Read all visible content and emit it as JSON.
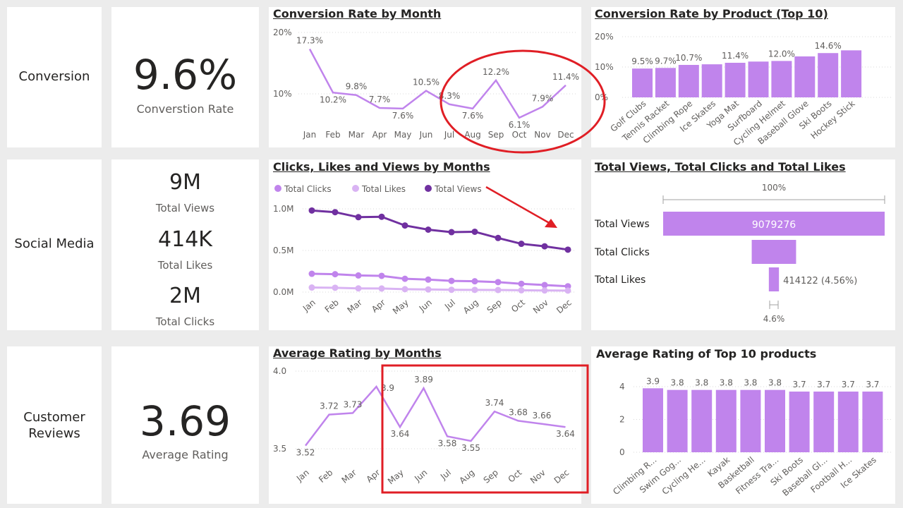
{
  "colors": {
    "accent": "#c084ec",
    "dark": "#7030a0",
    "light": "#d9b3f3",
    "annotation": "#e01e25"
  },
  "sections": {
    "conversion": "Conversion",
    "social": "Social Media",
    "reviews_line1": "Customer",
    "reviews_line2": "Reviews"
  },
  "kpis": {
    "conversion_value": "9.6%",
    "conversion_label": "Converstion Rate",
    "views_value": "9M",
    "views_label": "Total Views",
    "likes_value": "414K",
    "likes_label": "Total Likes",
    "clicks_value": "2M",
    "clicks_label": "Total Clicks",
    "rating_value": "3.69",
    "rating_label": "Average Rating"
  },
  "months": [
    "Jan",
    "Feb",
    "Mar",
    "Apr",
    "May",
    "Jun",
    "Jul",
    "Aug",
    "Sep",
    "Oct",
    "Nov",
    "Dec"
  ],
  "chart_data": [
    {
      "type": "line",
      "title": "Conversion Rate by Month",
      "x": [
        "Jan",
        "Feb",
        "Mar",
        "Apr",
        "May",
        "Jun",
        "Jul",
        "Aug",
        "Sep",
        "Oct",
        "Nov",
        "Dec"
      ],
      "values": [
        17.3,
        10.2,
        9.8,
        7.7,
        7.6,
        10.5,
        8.3,
        7.6,
        12.2,
        6.1,
        7.9,
        11.4
      ],
      "labels": [
        "17.3%",
        "10.2%",
        "9.8%",
        "7.7%",
        "7.6%",
        "10.5%",
        "8.3%",
        "7.6%",
        "12.2%",
        "6.1%",
        "7.9%",
        "11.4%"
      ],
      "yticks": [
        "20%",
        "10%"
      ],
      "ylim": [
        0,
        20
      ]
    },
    {
      "type": "bar",
      "title": "Conversion Rate by Product (Top 10)",
      "categories": [
        "Golf Clubs",
        "Tennis Racket",
        "Climbing Rope",
        "Ice Skates",
        "Yoga Mat",
        "Surfboard",
        "Cycling Helmet",
        "Baseball Glove",
        "Ski Boots",
        "Hockey Stick"
      ],
      "values": [
        9.5,
        9.7,
        10.7,
        10.9,
        11.4,
        11.8,
        12.0,
        13.5,
        14.6,
        15.5
      ],
      "labels": [
        "9.5%",
        "9.7%",
        "10.7%",
        "",
        "11.4%",
        "",
        "12.0%",
        "",
        "14.6%",
        ""
      ],
      "yticks": [
        "20%",
        "10%",
        "0%"
      ],
      "ylim": [
        0,
        20
      ]
    },
    {
      "type": "line",
      "title": "Clicks, Likes and Views by Months",
      "x": [
        "Jan",
        "Feb",
        "Mar",
        "Apr",
        "May",
        "Jun",
        "Jul",
        "Aug",
        "Sep",
        "Oct",
        "Nov",
        "Dec"
      ],
      "series": [
        {
          "name": "Total Clicks",
          "values": [
            220000,
            215000,
            200000,
            195000,
            160000,
            150000,
            135000,
            130000,
            120000,
            100000,
            85000,
            70000
          ]
        },
        {
          "name": "Total Likes",
          "values": [
            55000,
            52000,
            45000,
            43000,
            35000,
            32000,
            28000,
            27000,
            25000,
            22000,
            20000,
            18000
          ]
        },
        {
          "name": "Total Views",
          "values": [
            980000,
            960000,
            900000,
            905000,
            800000,
            750000,
            720000,
            725000,
            650000,
            580000,
            550000,
            510000
          ]
        }
      ],
      "yticks": [
        "1.0M",
        "0.5M",
        "0.0M"
      ],
      "ylim": [
        0,
        1000000
      ]
    },
    {
      "type": "bar",
      "title": "Total Views, Total Clicks and Total Likes",
      "top_label": "100%",
      "bottom_label": "4.6%",
      "categories": [
        "Total Views",
        "Total Clicks",
        "Total Likes"
      ],
      "values": [
        9079276,
        1818000,
        414122
      ],
      "labels": [
        "9079276",
        "",
        "414122 (4.56%)"
      ]
    },
    {
      "type": "line",
      "title": "Average Rating by Months",
      "x": [
        "Jan",
        "Feb",
        "Mar",
        "Apr",
        "May",
        "Jun",
        "Jul",
        "Aug",
        "Sep",
        "Oct",
        "Nov",
        "Dec"
      ],
      "values": [
        3.52,
        3.72,
        3.73,
        3.9,
        3.64,
        3.89,
        3.58,
        3.55,
        3.74,
        3.68,
        3.66,
        3.64
      ],
      "labels": [
        "3.52",
        "3.72",
        "3.73",
        "3.9",
        "3.64",
        "3.89",
        "3.58",
        "3.55",
        "3.74",
        "3.68",
        "3.66",
        "3.64"
      ],
      "yticks": [
        "4.0",
        "3.5"
      ],
      "ylim": [
        3.5,
        4.0
      ]
    },
    {
      "type": "bar",
      "title": "Average Rating of Top 10 products",
      "categories": [
        "Climbing R...",
        "Swim Gog...",
        "Cycling He...",
        "Kayak",
        "Basketball",
        "Fitness Tra...",
        "Ski Boots",
        "Baseball Gl...",
        "Football H...",
        "Ice Skates"
      ],
      "values": [
        3.9,
        3.8,
        3.8,
        3.8,
        3.8,
        3.8,
        3.7,
        3.7,
        3.7,
        3.7
      ],
      "labels": [
        "3.9",
        "3.8",
        "3.8",
        "3.8",
        "3.8",
        "3.8",
        "3.7",
        "3.7",
        "3.7",
        "3.7"
      ],
      "yticks": [
        "4",
        "2",
        "0"
      ],
      "ylim": [
        0,
        4
      ]
    }
  ]
}
